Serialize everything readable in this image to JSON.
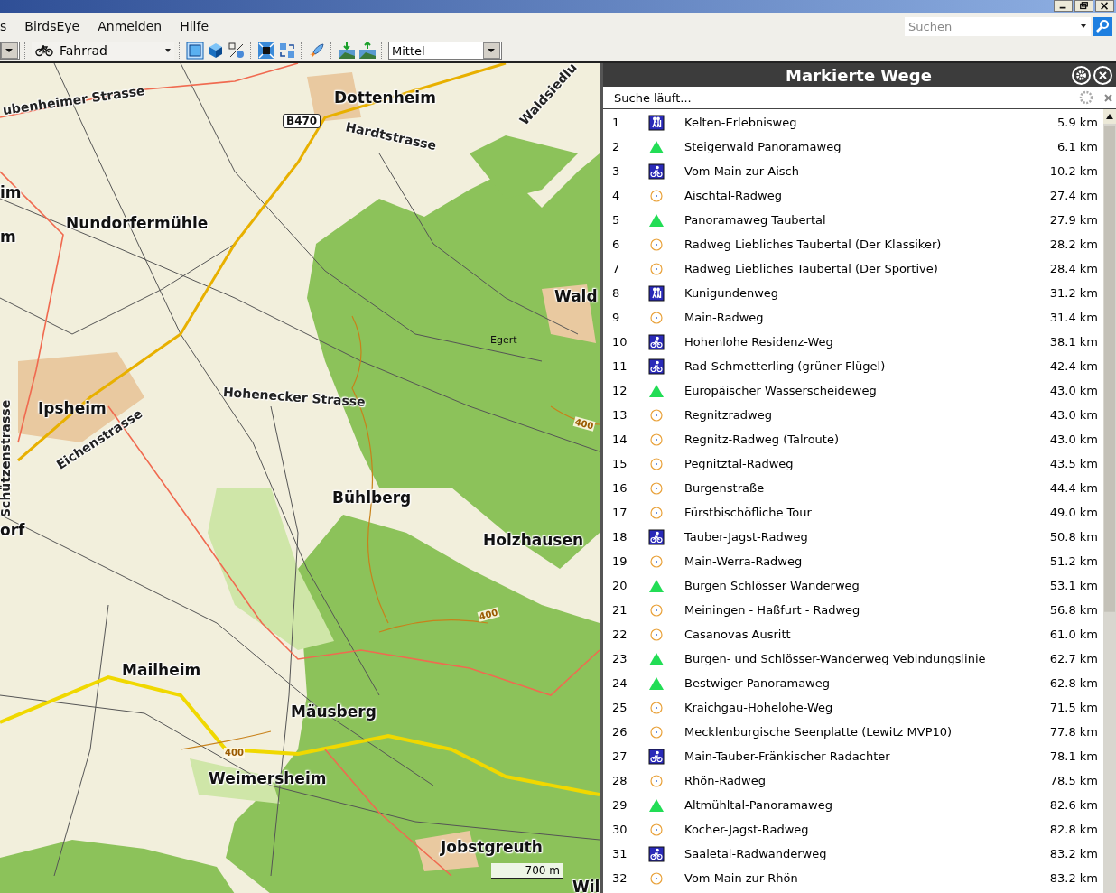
{
  "menu": [
    "s",
    "BirdsEye",
    "Anmelden",
    "Hilfe"
  ],
  "toolbar": {
    "profile": "Fahrrad",
    "detail": "Mittel"
  },
  "search": {
    "placeholder": "Suchen"
  },
  "map": {
    "labels": [
      {
        "text": "ubenheimer Strasse",
        "kind": "street"
      },
      {
        "text": "Dottenheim",
        "kind": "place"
      },
      {
        "text": "B470",
        "kind": "road-number"
      },
      {
        "text": "Hardtstrasse",
        "kind": "street"
      },
      {
        "text": "Waldsiedlu",
        "kind": "street"
      },
      {
        "text": "im",
        "kind": "place"
      },
      {
        "text": "Nundorfermühle",
        "kind": "place"
      },
      {
        "text": "m",
        "kind": "place"
      },
      {
        "text": "Wald",
        "kind": "place"
      },
      {
        "text": "Egert",
        "kind": "small"
      },
      {
        "text": "Hohenecker Strasse",
        "kind": "street"
      },
      {
        "text": "Ipsheim",
        "kind": "place"
      },
      {
        "text": "Eichenstrasse",
        "kind": "street"
      },
      {
        "text": "Schützenstrasse",
        "kind": "street"
      },
      {
        "text": "400",
        "kind": "contour"
      },
      {
        "text": "orf",
        "kind": "place"
      },
      {
        "text": "Bühlberg",
        "kind": "place"
      },
      {
        "text": "Holzhausen",
        "kind": "place"
      },
      {
        "text": "400",
        "kind": "contour"
      },
      {
        "text": "Mailheim",
        "kind": "place"
      },
      {
        "text": "Mäusberg",
        "kind": "place"
      },
      {
        "text": "400",
        "kind": "contour"
      },
      {
        "text": "Weimersheim",
        "kind": "place"
      },
      {
        "text": "Jobstgreuth",
        "kind": "place"
      },
      {
        "text": "Wil",
        "kind": "place"
      }
    ],
    "scale": "700 m"
  },
  "panel": {
    "title": "Markierte Wege",
    "status": "Suche läuft...",
    "routes": [
      {
        "num": "1",
        "kind": "hike",
        "name": "Kelten-Erlebnisweg",
        "distance": "5.9 km"
      },
      {
        "num": "2",
        "kind": "triangle",
        "name": "Steigerwald Panoramaweg",
        "distance": "6.1 km"
      },
      {
        "num": "3",
        "kind": "bike",
        "name": "Vom Main zur Aisch",
        "distance": "10.2 km"
      },
      {
        "num": "4",
        "kind": "circle",
        "name": "Aischtal-Radweg",
        "distance": "27.4 km"
      },
      {
        "num": "5",
        "kind": "triangle",
        "name": "Panoramaweg Taubertal",
        "distance": "27.9 km"
      },
      {
        "num": "6",
        "kind": "circle",
        "name": "Radweg Liebliches Taubertal (Der Klassiker)",
        "distance": "28.2 km"
      },
      {
        "num": "7",
        "kind": "circle",
        "name": "Radweg Liebliches Taubertal (Der Sportive)",
        "distance": "28.4 km"
      },
      {
        "num": "8",
        "kind": "hike",
        "name": "Kunigundenweg",
        "distance": "31.2 km"
      },
      {
        "num": "9",
        "kind": "circle",
        "name": "Main-Radweg",
        "distance": "31.4 km"
      },
      {
        "num": "10",
        "kind": "bike",
        "name": "Hohenlohe Residenz-Weg",
        "distance": "38.1 km"
      },
      {
        "num": "11",
        "kind": "bike",
        "name": "Rad-Schmetterling (grüner Flügel)",
        "distance": "42.4 km"
      },
      {
        "num": "12",
        "kind": "triangle",
        "name": "Europäischer Wasserscheideweg",
        "distance": "43.0 km"
      },
      {
        "num": "13",
        "kind": "circle",
        "name": "Regnitzradweg",
        "distance": "43.0 km"
      },
      {
        "num": "14",
        "kind": "circle",
        "name": "Regnitz-Radweg (Talroute)",
        "distance": "43.0 km"
      },
      {
        "num": "15",
        "kind": "circle",
        "name": "Pegnitztal-Radweg",
        "distance": "43.5 km"
      },
      {
        "num": "16",
        "kind": "circle",
        "name": "Burgenstraße",
        "distance": "44.4 km"
      },
      {
        "num": "17",
        "kind": "circle",
        "name": "Fürstbischöfliche Tour",
        "distance": "49.0 km"
      },
      {
        "num": "18",
        "kind": "bike",
        "name": "Tauber-Jagst-Radweg",
        "distance": "50.8 km"
      },
      {
        "num": "19",
        "kind": "circle",
        "name": "Main-Werra-Radweg",
        "distance": "51.2 km"
      },
      {
        "num": "20",
        "kind": "triangle",
        "name": "Burgen Schlösser Wanderweg",
        "distance": "53.1 km"
      },
      {
        "num": "21",
        "kind": "circle",
        "name": "Meiningen - Haßfurt - Radweg",
        "distance": "56.8 km"
      },
      {
        "num": "22",
        "kind": "circle",
        "name": "Casanovas Ausritt",
        "distance": "61.0 km"
      },
      {
        "num": "23",
        "kind": "triangle",
        "name": "Burgen- und Schlösser-Wanderweg Vebindungslinie",
        "distance": "62.7 km"
      },
      {
        "num": "24",
        "kind": "triangle",
        "name": "Bestwiger Panoramaweg",
        "distance": "62.8 km"
      },
      {
        "num": "25",
        "kind": "circle",
        "name": "Kraichgau-Hohelohe-Weg",
        "distance": "71.5 km"
      },
      {
        "num": "26",
        "kind": "circle",
        "name": "Mecklenburgische Seenplatte (Lewitz MVP10)",
        "distance": "77.8 km"
      },
      {
        "num": "27",
        "kind": "bike",
        "name": "Main-Tauber-Fränkischer Radachter",
        "distance": "78.1 km"
      },
      {
        "num": "28",
        "kind": "circle",
        "name": "Rhön-Radweg",
        "distance": "78.5 km"
      },
      {
        "num": "29",
        "kind": "triangle",
        "name": "Altmühltal-Panoramaweg",
        "distance": "82.6 km"
      },
      {
        "num": "30",
        "kind": "circle",
        "name": "Kocher-Jagst-Radweg",
        "distance": "82.8 km"
      },
      {
        "num": "31",
        "kind": "bike",
        "name": "Saaletal-Radwanderweg",
        "distance": "83.2 km"
      },
      {
        "num": "32",
        "kind": "circle",
        "name": "Vom Main zur Rhön",
        "distance": "83.2 km"
      }
    ]
  }
}
